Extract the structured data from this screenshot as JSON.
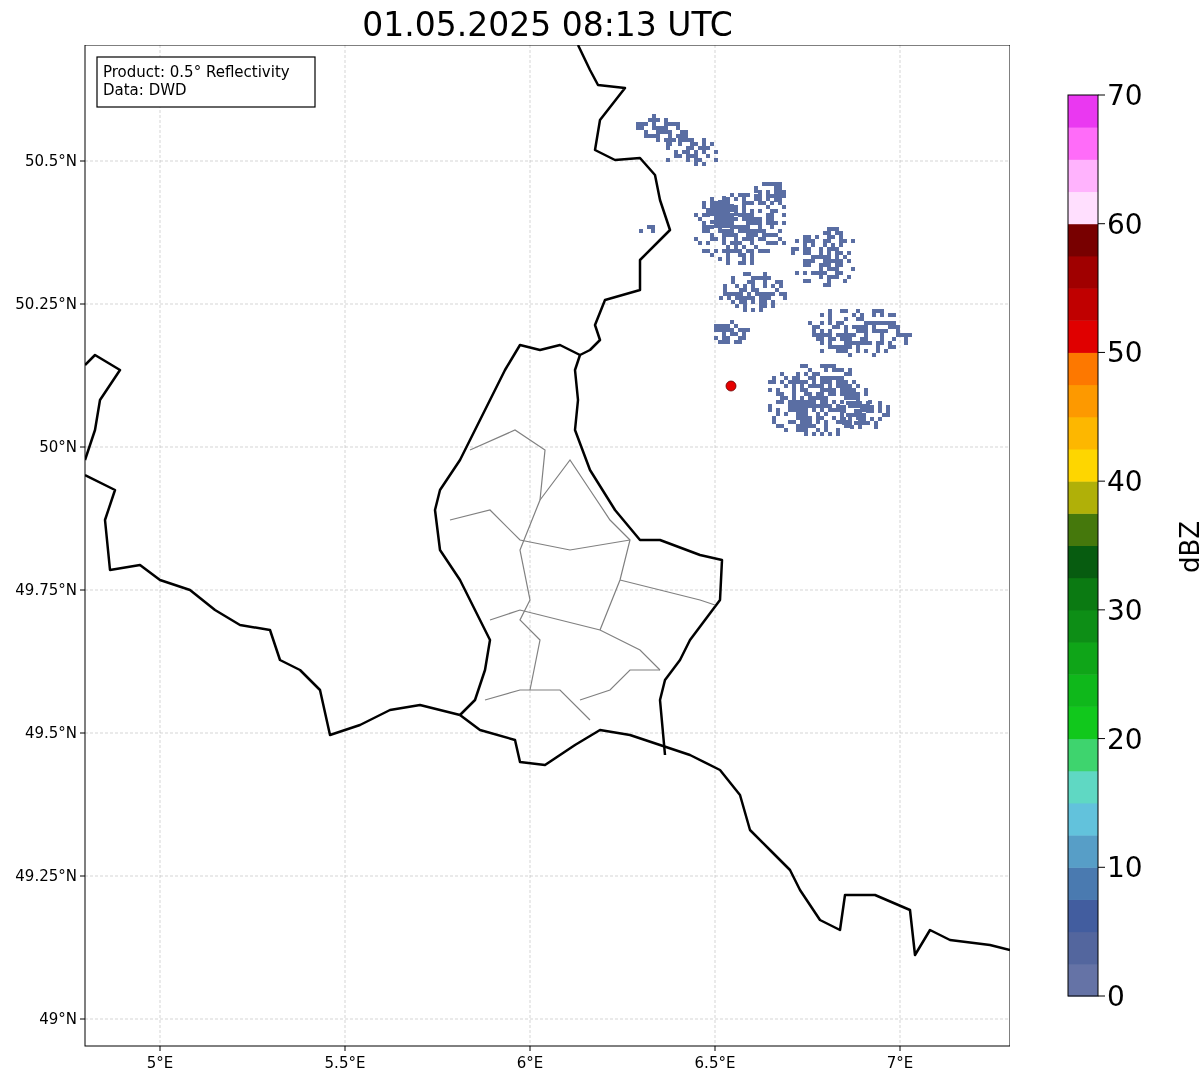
{
  "title": "01.05.2025 08:13 UTC",
  "map": {
    "info_box": [
      "Product: 0.5° Reflectivity",
      "Data: DWD"
    ],
    "lat_labels": [
      "50.5°N",
      "50.25°N",
      "50°N",
      "49.75°N",
      "49.5°N",
      "49.25°N",
      "49°N"
    ],
    "lon_labels": [
      "5°E",
      "5.5°E",
      "6°E",
      "6.5°E",
      "7°E"
    ]
  },
  "colorbar": {
    "label": "dBZ",
    "ticks": [
      "70",
      "60",
      "50",
      "40",
      "30",
      "20",
      "10",
      "0"
    ],
    "segments": [
      {
        "color": "#6573a6"
      },
      {
        "color": "#53669e"
      },
      {
        "color": "#425d9f"
      },
      {
        "color": "#4a7ab0"
      },
      {
        "color": "#579ec7"
      },
      {
        "color": "#62c2dc"
      },
      {
        "color": "#5fd8c3"
      },
      {
        "color": "#3ed46e"
      },
      {
        "color": "#11c81c"
      },
      {
        "color": "#0fb81b"
      },
      {
        "color": "#0fa518"
      },
      {
        "color": "#0d8e16"
      },
      {
        "color": "#0b7a12"
      },
      {
        "color": "#075c10"
      },
      {
        "color": "#45780c"
      },
      {
        "color": "#b0b008"
      },
      {
        "color": "#fed600"
      },
      {
        "color": "#fdb700"
      },
      {
        "color": "#fd9900"
      },
      {
        "color": "#fd7800"
      },
      {
        "color": "#e00000"
      },
      {
        "color": "#c00000"
      },
      {
        "color": "#a00000"
      },
      {
        "color": "#780000"
      },
      {
        "color": "#ffdffe"
      },
      {
        "color": "#ffb3fd"
      },
      {
        "color": "#ff6cf9"
      },
      {
        "color": "#ea38f1"
      }
    ]
  }
}
